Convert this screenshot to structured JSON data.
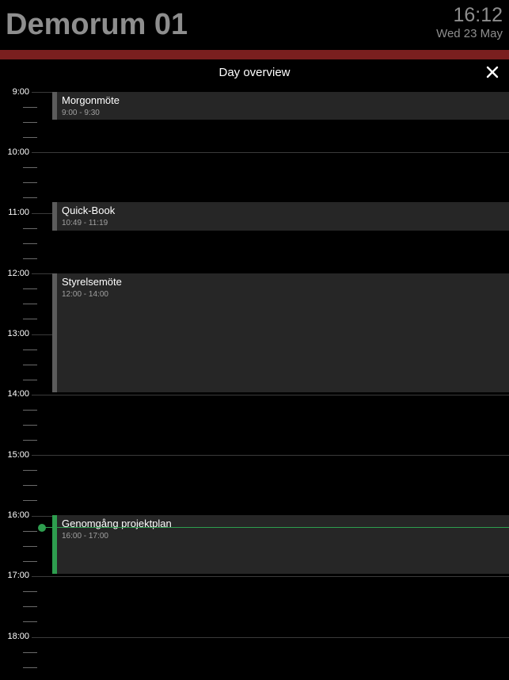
{
  "header": {
    "room_name": "Demorum 01",
    "clock": "16:12",
    "date": "Wed 23 May",
    "status_color": "#7a1f1f"
  },
  "overview": {
    "title": "Day overview",
    "close_icon": "close-icon"
  },
  "timeline": {
    "hours": [
      "9:00",
      "10:00",
      "11:00",
      "12:00",
      "13:00",
      "14:00",
      "15:00",
      "16:00",
      "17:00",
      "18:00"
    ],
    "now": "16:12",
    "accent_color": "#2e9e4f"
  },
  "events": [
    {
      "title": "Morgonmöte",
      "time": "9:00 - 9:30",
      "current": false
    },
    {
      "title": "Quick-Book",
      "time": "10:49 - 11:19",
      "current": false
    },
    {
      "title": "Styrelsemöte",
      "time": "12:00 - 14:00",
      "current": false
    },
    {
      "title": "Genomgång projektplan",
      "time": "16:00 - 17:00",
      "current": true
    }
  ]
}
